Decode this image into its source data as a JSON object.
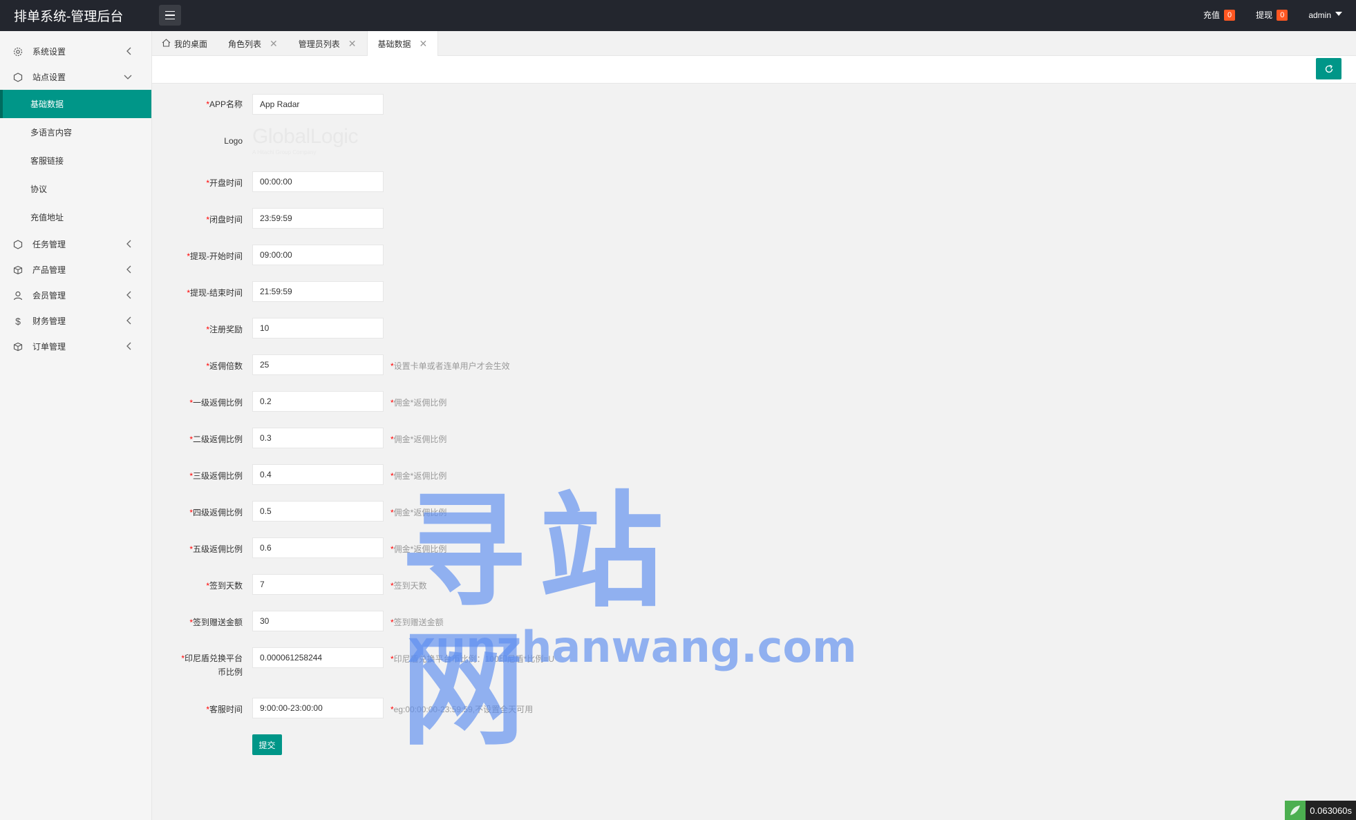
{
  "header": {
    "brand": "排单系统-管理后台",
    "recharge_label": "充值",
    "recharge_count": "0",
    "withdraw_label": "提现",
    "withdraw_count": "0",
    "user": "admin"
  },
  "sidebar": {
    "items": [
      {
        "label": "系统设置",
        "icon": "gear-icon"
      },
      {
        "label": "站点设置",
        "icon": "site-icon"
      },
      {
        "label": "任务管理",
        "icon": "task-icon"
      },
      {
        "label": "产品管理",
        "icon": "box-icon"
      },
      {
        "label": "会员管理",
        "icon": "user-icon"
      },
      {
        "label": "财务管理",
        "icon": "dollar-icon"
      },
      {
        "label": "订单管理",
        "icon": "order-icon"
      }
    ],
    "sub_items": [
      "基础数据",
      "多语言内容",
      "客服链接",
      "协议",
      "充值地址"
    ]
  },
  "tabs": [
    {
      "label": "我的桌面"
    },
    {
      "label": "角色列表"
    },
    {
      "label": "管理员列表"
    },
    {
      "label": "基础数据"
    }
  ],
  "form": {
    "app_name": {
      "label": "APP名称",
      "value": "App Radar"
    },
    "logo": {
      "label": "Logo",
      "text_main": "GlobalLogic",
      "text_sub": "A Hitachi Group Company"
    },
    "open_time": {
      "label": "开盘时间",
      "value": "00:00:00"
    },
    "close_time": {
      "label": "闭盘时间",
      "value": "23:59:59"
    },
    "withdraw_start": {
      "label": "提现-开始时间",
      "value": "09:00:00"
    },
    "withdraw_end": {
      "label": "提现-结束时间",
      "value": "21:59:59"
    },
    "register_reward": {
      "label": "注册奖励",
      "value": "10"
    },
    "rebate_multiple": {
      "label": "返佣倍数",
      "value": "25",
      "hint": "设置卡单或者连单用户才会生效"
    },
    "level1": {
      "label": "一级返佣比例",
      "value": "0.2",
      "hint": "佣金*返佣比例"
    },
    "level2": {
      "label": "二级返佣比例",
      "value": "0.3",
      "hint": "佣金*返佣比例"
    },
    "level3": {
      "label": "三级返佣比例",
      "value": "0.4",
      "hint": "佣金*返佣比例"
    },
    "level4": {
      "label": "四级返佣比例",
      "value": "0.5",
      "hint": "佣金*返佣比例"
    },
    "level5": {
      "label": "五级返佣比例",
      "value": "0.6",
      "hint": "佣金*返佣比例"
    },
    "signin_days": {
      "label": "签到天数",
      "value": "7",
      "hint": "签到天数"
    },
    "signin_bonus": {
      "label": "签到赠送金额",
      "value": "30",
      "hint": "签到赠送金额"
    },
    "idr_rate": {
      "label_line1": "印尼盾兑换平台",
      "label_line2": "币比例",
      "value": "0.000061258244",
      "hint": "印尼盾兑换平台币比例：100印尼盾*比例=U"
    },
    "service_time": {
      "label": "客服时间",
      "value": "9:00:00-23:00:00",
      "hint": "eg:00:00:00-23:59:59,不设置全天可用"
    },
    "submit_label": "提交"
  },
  "watermark": {
    "main": "寻站网",
    "sub": "xunzhanwang.com"
  },
  "timer": "0.063060s",
  "colors": {
    "accent": "#009688",
    "header": "#23262e",
    "badge": "#ff5722"
  }
}
